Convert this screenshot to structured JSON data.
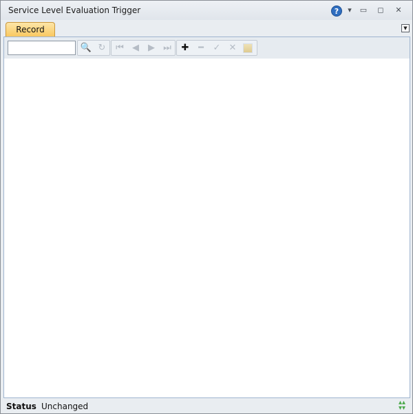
{
  "window": {
    "title": "Service Level Evaluation Trigger",
    "help_symbol": "?",
    "dropdown_symbol": "▾",
    "minimize_symbol": "▭",
    "restore_symbol": "◻",
    "close_symbol": "✕"
  },
  "tabs": {
    "record_label": "Record",
    "menu_symbol": "▼"
  },
  "toolbar": {
    "search_value": "",
    "search_placeholder": "",
    "icons": {
      "find": "🔍",
      "refresh": "↻",
      "first": "⏮",
      "previous": "◀",
      "next": "▶",
      "last": "⏭",
      "add": "✚",
      "delete": "━",
      "confirm": "✓",
      "cancel": "✕"
    }
  },
  "status": {
    "label": "Status",
    "value": "Unchanged"
  },
  "colors": {
    "tab_active": "#f9c860",
    "help_icon": "#2f6ec0",
    "resize_icon": "#4aa84a"
  }
}
